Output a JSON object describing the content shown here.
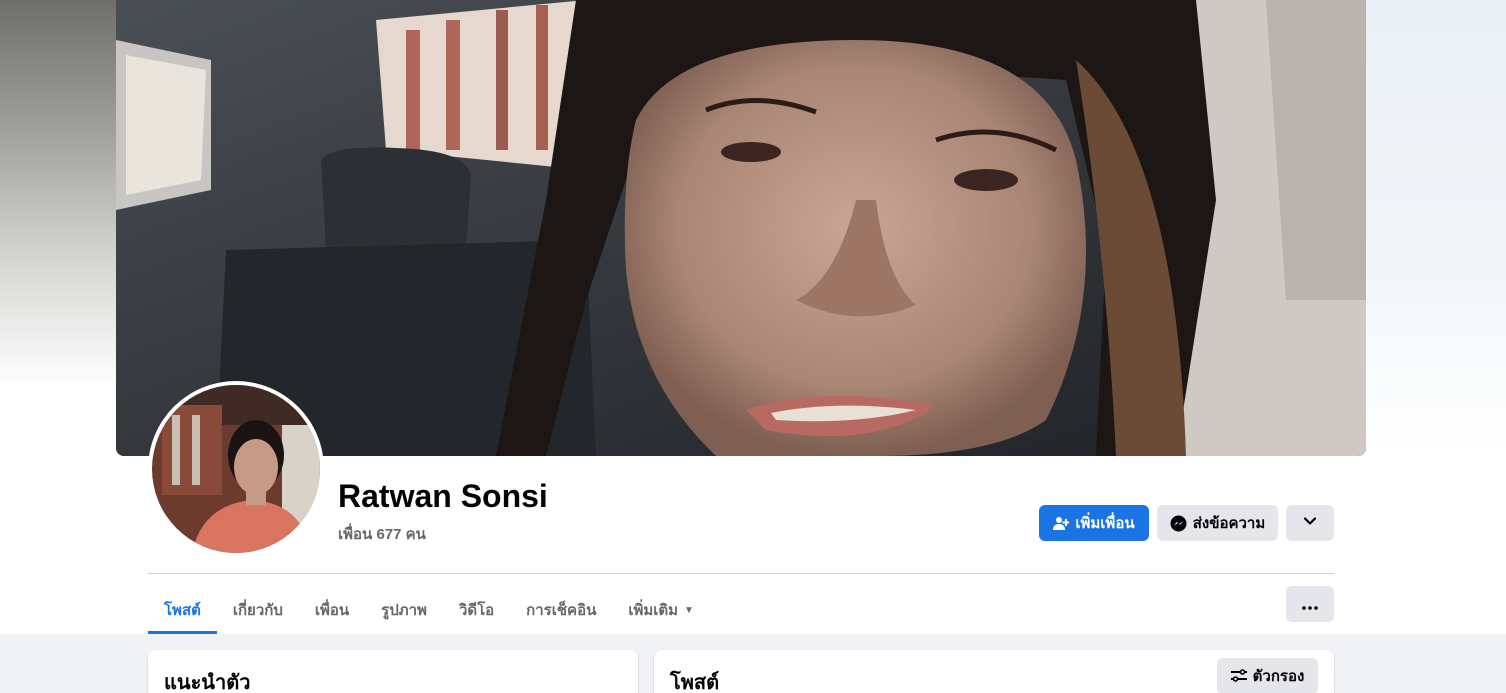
{
  "profile": {
    "name": "Ratwan Sonsi",
    "friends_text": "เพื่อน 677 คน"
  },
  "actions": {
    "add_friend_label": "เพิ่มเพื่อน",
    "message_label": "ส่งข้อความ",
    "more_icon": "chevron-down-icon"
  },
  "tabs": [
    {
      "label": "โพสต์",
      "active": true
    },
    {
      "label": "เกี่ยวกับ",
      "active": false
    },
    {
      "label": "เพื่อน",
      "active": false
    },
    {
      "label": "รูปภาพ",
      "active": false
    },
    {
      "label": "วิดีโอ",
      "active": false
    },
    {
      "label": "การเช็คอิน",
      "active": false
    },
    {
      "label": "เพิ่มเติม",
      "active": false
    }
  ],
  "tab_options_icon": "ellipsis-icon",
  "intro_card": {
    "title": "แนะนำตัว"
  },
  "posts_card": {
    "title": "โพสต์",
    "filter_label": "ตัวกรอง"
  },
  "colors": {
    "accent": "#1b74e4",
    "secondary_button": "#e4e6eb",
    "page_bg": "#f0f2f5",
    "muted_text": "#65676b"
  }
}
